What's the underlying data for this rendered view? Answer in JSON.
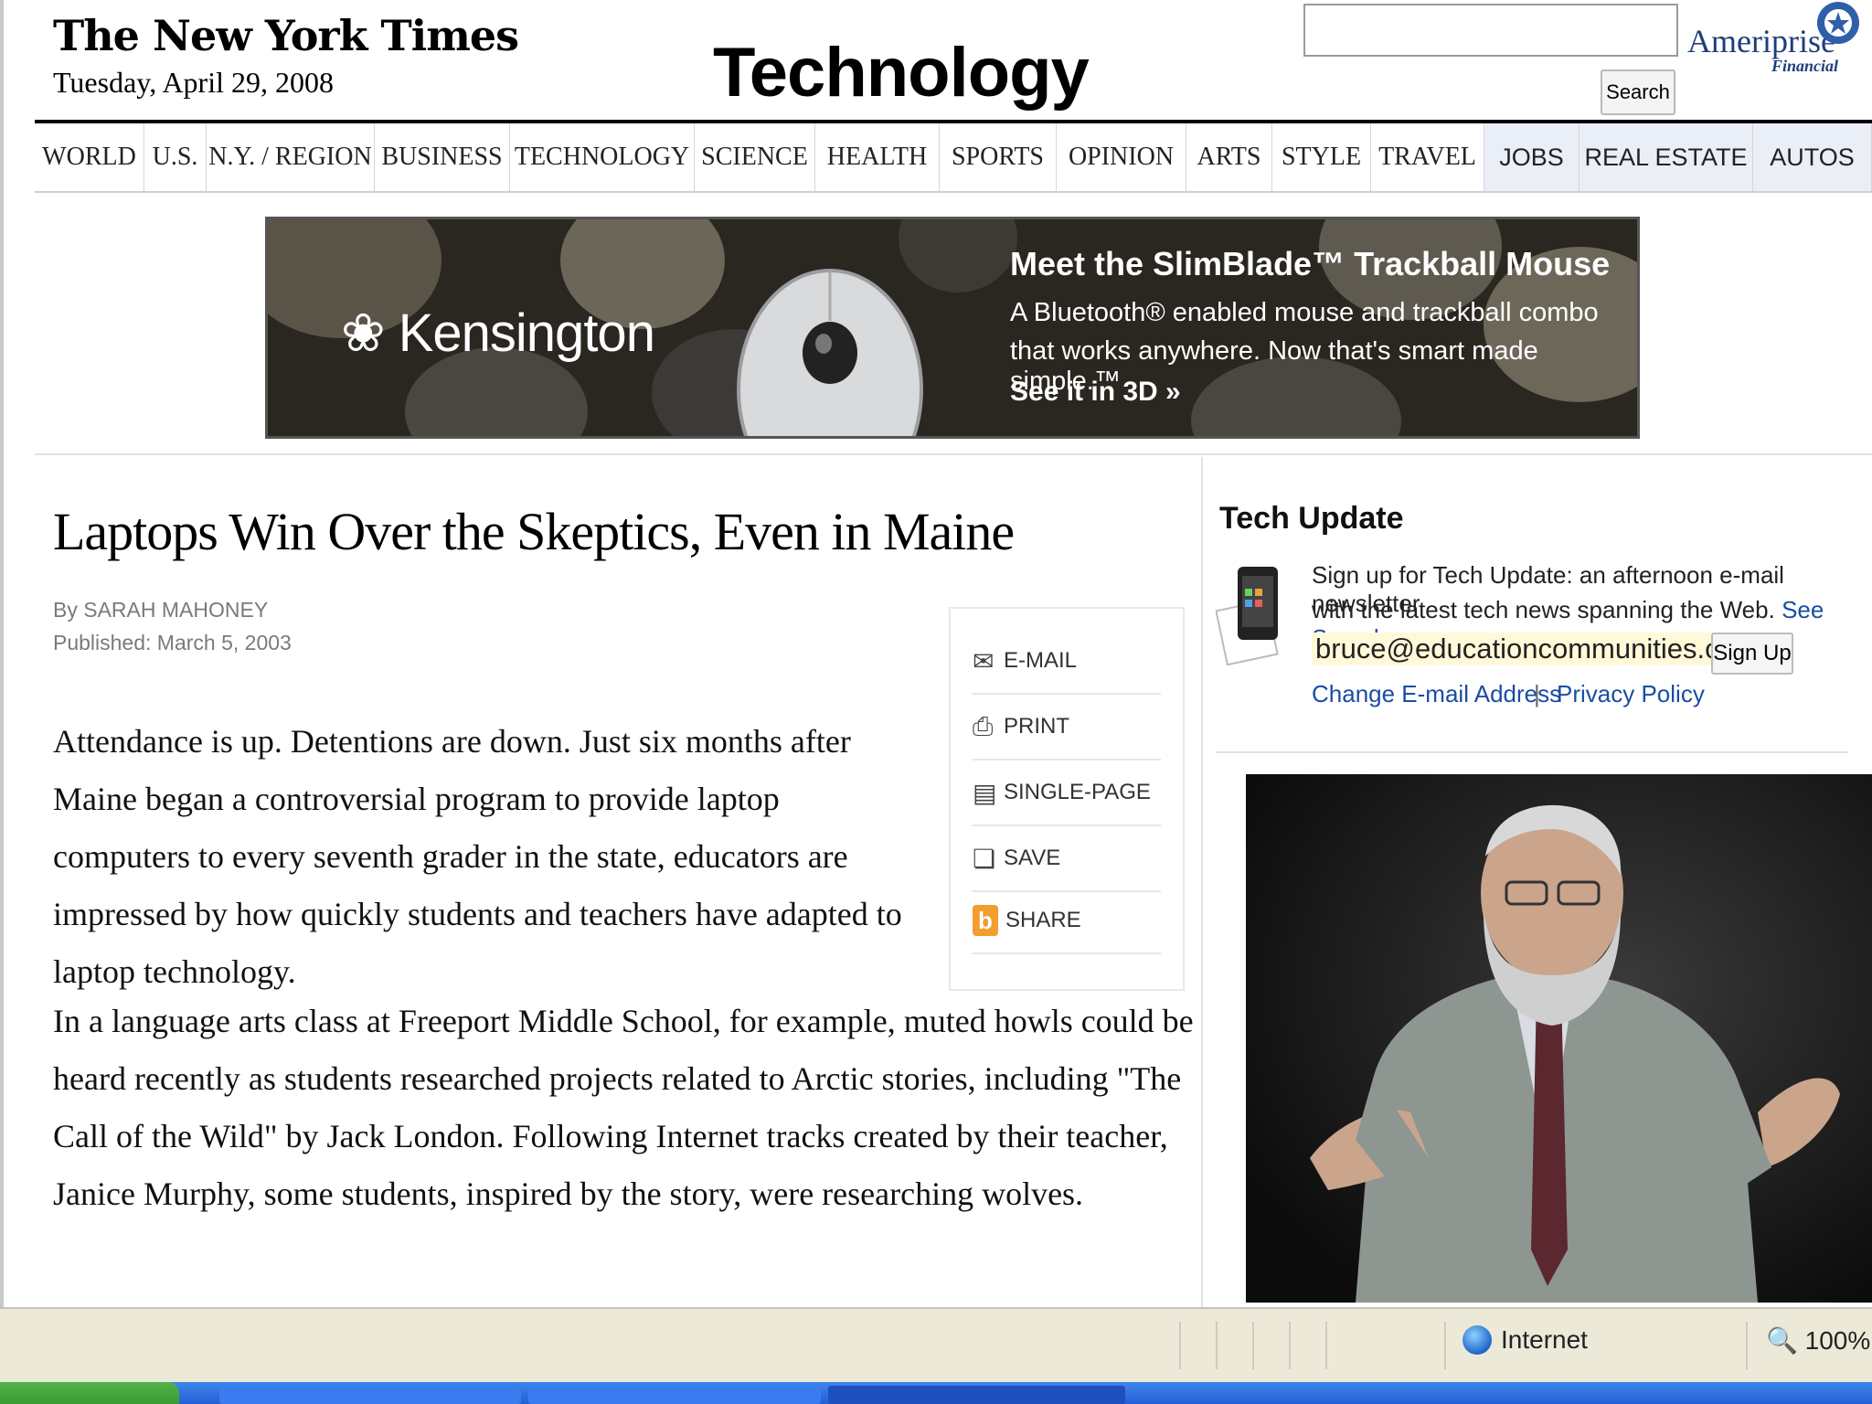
{
  "masthead": {
    "logo": "The New York Times",
    "date": "Tuesday, April 29, 2008",
    "section": "Technology",
    "search_button": "Search",
    "search_placeholder": "",
    "sponsor": "Ameriprise",
    "sponsor_sub": "Financial"
  },
  "nav": [
    "WORLD",
    "U.S.",
    "N.Y. / REGION",
    "BUSINESS",
    "TECHNOLOGY",
    "SCIENCE",
    "HEALTH",
    "SPORTS",
    "OPINION",
    "ARTS",
    "STYLE",
    "TRAVEL",
    "JOBS",
    "REAL ESTATE",
    "AUTOS"
  ],
  "ad": {
    "brand": "Kensington",
    "headline": "Meet the SlimBlade™ Trackball Mouse",
    "line1": "A Bluetooth® enabled mouse and trackball combo",
    "line2": "that works anywhere. Now that's smart made simple.™",
    "cta": "See it in 3D »"
  },
  "article": {
    "headline": "Laptops Win Over the Skeptics, Even in Maine",
    "byline": "By SARAH MAHONEY",
    "published": "Published: March 5, 2003",
    "para1": "Attendance is up. Detentions are down. Just six months after Maine began a controversial program to provide laptop computers to every seventh grader in the state, educators are impressed by how quickly students and teachers have adapted to laptop technology.",
    "para2": "In a language arts class at Freeport Middle School, for example, muted howls could be heard recently as students researched projects related to Arctic stories, including \"The Call of the Wild\" by Jack London. Following Internet tracks created by their teacher, Janice Murphy, some students, inspired by the story, were researching wolves."
  },
  "toolbox": {
    "email": "E-MAIL",
    "print": "PRINT",
    "single_page": "SINGLE-PAGE",
    "save": "SAVE",
    "share": "SHARE"
  },
  "tech_update": {
    "title": "Tech Update",
    "text1": "Sign up for Tech Update: an afternoon e-mail newsletter",
    "text2_pre": "with the latest tech news spanning the Web.",
    "see_sample": "See Sample",
    "email": "bruce@educationcommunities.com",
    "signup_button": "Sign Up",
    "change_email": "Change E-mail Address",
    "separator": "|",
    "privacy": "Privacy Policy"
  },
  "statusbar": {
    "zone": "Internet",
    "zoom": "100%"
  },
  "colors": {
    "link": "#1a4da3",
    "nav_alt_bg": "#eaeef6",
    "statusbar_bg": "#ece9d8",
    "taskbar": "#245ed8"
  }
}
